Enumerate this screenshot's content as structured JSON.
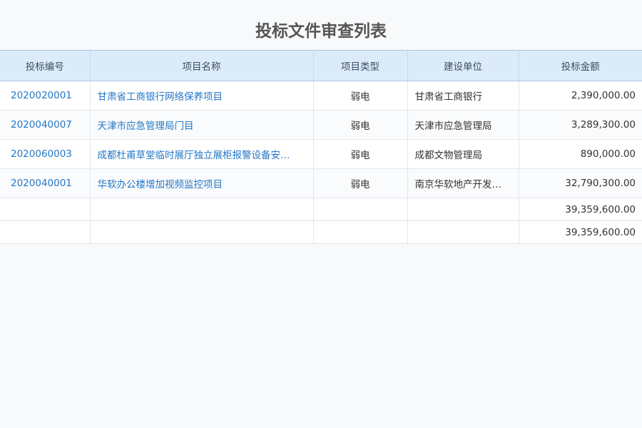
{
  "page": {
    "title": "投标文件审查列表"
  },
  "table": {
    "headers": [
      "投标编号",
      "项目名称",
      "项目类型",
      "建设单位",
      "投标金额"
    ],
    "rows": [
      {
        "code": "2020020001",
        "name": "甘肃省工商银行网络保养项目",
        "type": "弱电",
        "unit": "甘肃省工商银行",
        "amount": "2,390,000.00"
      },
      {
        "code": "2020040007",
        "name": "天津市应急管理局门目",
        "type": "弱电",
        "unit": "天津市应急管理局",
        "amount": "3,289,300.00"
      },
      {
        "code": "2020060003",
        "name": "成都杜甫草堂临时展厅独立展柜报警设备安…",
        "type": "弱电",
        "unit": "成都文物管理局",
        "amount": "890,000.00"
      },
      {
        "code": "2020040001",
        "name": "华软办公楼增加视频监控项目",
        "type": "弱电",
        "unit": "南京华软地产开发…",
        "amount": "32,790,300.00"
      }
    ],
    "summary": [
      "39,359,600.00",
      "39,359,600.00"
    ]
  }
}
